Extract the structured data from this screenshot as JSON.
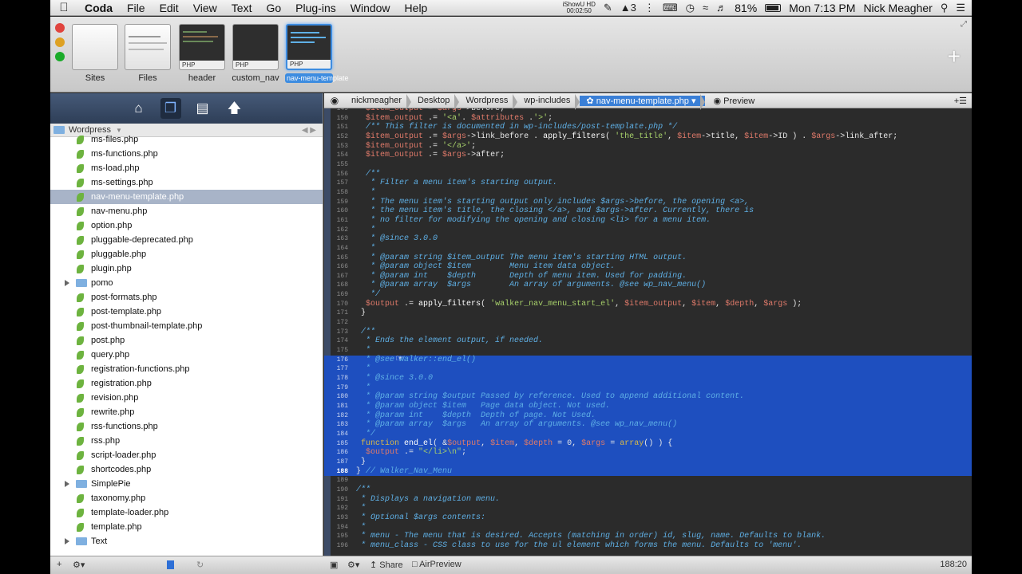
{
  "menubar": {
    "app": "Coda",
    "items": [
      "File",
      "Edit",
      "View",
      "Text",
      "Go",
      "Plug-ins",
      "Window",
      "Help"
    ],
    "recorder_top": "iShowU HD",
    "recorder_time": "00:02:50",
    "notif_count": "3",
    "battery": "81%",
    "clock": "Mon 7:13 PM",
    "user": "Nick Meagher"
  },
  "tabs": [
    {
      "label": "Sites"
    },
    {
      "label": "Files"
    },
    {
      "label": "header",
      "badge": "PHP"
    },
    {
      "label": "custom_nav",
      "badge": "PHP"
    },
    {
      "label": "nav-menu-template",
      "badge": "PHP"
    }
  ],
  "sidebar": {
    "crumb": "Wordpress",
    "files": [
      {
        "name": "ms-files.php",
        "type": "file"
      },
      {
        "name": "ms-functions.php",
        "type": "file"
      },
      {
        "name": "ms-load.php",
        "type": "file"
      },
      {
        "name": "ms-settings.php",
        "type": "file"
      },
      {
        "name": "nav-menu-template.php",
        "type": "file",
        "selected": true
      },
      {
        "name": "nav-menu.php",
        "type": "file"
      },
      {
        "name": "option.php",
        "type": "file"
      },
      {
        "name": "pluggable-deprecated.php",
        "type": "file"
      },
      {
        "name": "pluggable.php",
        "type": "file"
      },
      {
        "name": "plugin.php",
        "type": "file"
      },
      {
        "name": "pomo",
        "type": "dir"
      },
      {
        "name": "post-formats.php",
        "type": "file"
      },
      {
        "name": "post-template.php",
        "type": "file"
      },
      {
        "name": "post-thumbnail-template.php",
        "type": "file"
      },
      {
        "name": "post.php",
        "type": "file"
      },
      {
        "name": "query.php",
        "type": "file"
      },
      {
        "name": "registration-functions.php",
        "type": "file"
      },
      {
        "name": "registration.php",
        "type": "file"
      },
      {
        "name": "revision.php",
        "type": "file"
      },
      {
        "name": "rewrite.php",
        "type": "file"
      },
      {
        "name": "rss-functions.php",
        "type": "file"
      },
      {
        "name": "rss.php",
        "type": "file"
      },
      {
        "name": "script-loader.php",
        "type": "file"
      },
      {
        "name": "shortcodes.php",
        "type": "file"
      },
      {
        "name": "SimplePie",
        "type": "dir"
      },
      {
        "name": "taxonomy.php",
        "type": "file"
      },
      {
        "name": "template-loader.php",
        "type": "file"
      },
      {
        "name": "template.php",
        "type": "file"
      },
      {
        "name": "Text",
        "type": "dir"
      }
    ]
  },
  "pathbar": {
    "crumbs": [
      "nickmeagher",
      "Desktop",
      "Wordpress",
      "wp-includes"
    ],
    "current": "nav-menu-template.php",
    "preview": "Preview"
  },
  "code": {
    "lines": [
      {
        "n": "149",
        "h": "\t<span class='vr'>$item_output</span> = <span class='vr'>$args</span>->before;",
        "hl": false
      },
      {
        "n": "150",
        "h": "\t<span class='vr'>$item_output</span> .= <span class='st'>'&lt;a'</span>. <span class='vr'>$attributes</span> .<span class='st'>'&gt;'</span>;",
        "hl": false
      },
      {
        "n": "151",
        "h": "\t<span class='cm'>/** This filter is documented in wp-includes/post-template.php */</span>",
        "hl": false
      },
      {
        "n": "152",
        "h": "\t<span class='vr'>$item_output</span> .= <span class='vr'>$args</span>->link_before . <span class='fn'>apply_filters</span>( <span class='st'>'the_title'</span>, <span class='vr'>$item</span>->title, <span class='vr'>$item</span>->ID ) . <span class='vr'>$args</span>->link_after;",
        "hl": false
      },
      {
        "n": "153",
        "h": "\t<span class='vr'>$item_output</span> .= <span class='st'>'&lt;/a&gt;'</span>;",
        "hl": false
      },
      {
        "n": "154",
        "h": "\t<span class='vr'>$item_output</span> .= <span class='vr'>$args</span>->after;",
        "hl": false
      },
      {
        "n": "155",
        "h": "",
        "hl": false
      },
      {
        "n": "156",
        "h": "\t<span class='cm'>/**</span>",
        "hl": false
      },
      {
        "n": "157",
        "h": "\t<span class='cm'> * Filter a menu item's starting output.</span>",
        "hl": false
      },
      {
        "n": "158",
        "h": "\t<span class='cm'> *</span>",
        "hl": false
      },
      {
        "n": "159",
        "h": "\t<span class='cm'> * The menu item's starting output only includes $args->before, the opening &lt;a&gt;,</span>",
        "hl": false
      },
      {
        "n": "160",
        "h": "\t<span class='cm'> * the menu item's title, the closing &lt;/a&gt;, and $args->after. Currently, there is</span>",
        "hl": false
      },
      {
        "n": "161",
        "h": "\t<span class='cm'> * no filter for modifying the opening and closing &lt;li&gt; for a menu item.</span>",
        "hl": false
      },
      {
        "n": "162",
        "h": "\t<span class='cm'> *</span>",
        "hl": false
      },
      {
        "n": "163",
        "h": "\t<span class='cm'> * @since 3.0.0</span>",
        "hl": false
      },
      {
        "n": "164",
        "h": "\t<span class='cm'> *</span>",
        "hl": false
      },
      {
        "n": "165",
        "h": "\t<span class='cm'> * @param string $item_output The menu item's starting HTML output.</span>",
        "hl": false
      },
      {
        "n": "166",
        "h": "\t<span class='cm'> * @param object $item        Menu item data object.</span>",
        "hl": false
      },
      {
        "n": "167",
        "h": "\t<span class='cm'> * @param int    $depth       Depth of menu item. Used for padding.</span>",
        "hl": false
      },
      {
        "n": "168",
        "h": "\t<span class='cm'> * @param array  $args        An array of arguments. @see wp_nav_menu()</span>",
        "hl": false
      },
      {
        "n": "169",
        "h": "\t<span class='cm'> */</span>",
        "hl": false
      },
      {
        "n": "170",
        "h": "\t<span class='vr'>$output</span> .= <span class='fn'>apply_filters</span>( <span class='st'>'walker_nav_menu_start_el'</span>, <span class='vr'>$item_output</span>, <span class='vr'>$item</span>, <span class='vr'>$depth</span>, <span class='vr'>$args</span> );",
        "hl": false
      },
      {
        "n": "171",
        "h": " }",
        "hl": false
      },
      {
        "n": "172",
        "h": "",
        "hl": false
      },
      {
        "n": "173",
        "h": "<span class='cm'> /**</span>",
        "hl": false
      },
      {
        "n": "174",
        "h": "<span class='cm'>  * Ends the element output, if needed.</span>",
        "hl": false
      },
      {
        "n": "175",
        "h": "<span class='cm'>  *</span>",
        "hl": false
      },
      {
        "n": "176",
        "h": "<span class='cm'>  * @see Walker::end_el()</span>",
        "hl": true
      },
      {
        "n": "177",
        "h": "<span class='cm'>  *</span>",
        "hl": true
      },
      {
        "n": "178",
        "h": "<span class='cm'>  * @since 3.0.0</span>",
        "hl": true
      },
      {
        "n": "179",
        "h": "<span class='cm'>  *</span>",
        "hl": true
      },
      {
        "n": "180",
        "h": "<span class='cm'>  * @param string $output Passed by reference. Used to append additional content.</span>",
        "hl": true
      },
      {
        "n": "181",
        "h": "<span class='cm'>  * @param object $item   Page data object. Not used.</span>",
        "hl": true
      },
      {
        "n": "182",
        "h": "<span class='cm'>  * @param int    $depth  Depth of page. Not Used.</span>",
        "hl": true
      },
      {
        "n": "183",
        "h": "<span class='cm'>  * @param array  $args   An array of arguments. @see wp_nav_menu()</span>",
        "hl": true
      },
      {
        "n": "184",
        "h": "<span class='cm'>  */</span>",
        "hl": true
      },
      {
        "n": "185",
        "h": " <span class='kw'>function</span> <span class='fn'>end_el</span>( &amp;<span class='vr'>$output</span>, <span class='vr'>$item</span>, <span class='vr'>$depth</span> = 0, <span class='vr'>$args</span> = <span class='kw'>array</span>() ) {",
        "hl": true
      },
      {
        "n": "186",
        "h": "\t<span class='vr'>$output</span> .= <span class='st'>\"&lt;/li&gt;\\n\"</span>;",
        "hl": true
      },
      {
        "n": "187",
        "h": " }",
        "hl": true
      },
      {
        "n": "188",
        "h": "} <span class='cm'>// Walker_Nav_Menu</span>",
        "hl": true,
        "cur": true
      },
      {
        "n": "189",
        "h": "",
        "hl": false
      },
      {
        "n": "190",
        "h": "<span class='cm'>/**</span>",
        "hl": false
      },
      {
        "n": "191",
        "h": "<span class='cm'> * Displays a navigation menu.</span>",
        "hl": false
      },
      {
        "n": "192",
        "h": "<span class='cm'> *</span>",
        "hl": false
      },
      {
        "n": "193",
        "h": "<span class='cm'> * Optional $args contents:</span>",
        "hl": false
      },
      {
        "n": "194",
        "h": "<span class='cm'> *</span>",
        "hl": false
      },
      {
        "n": "195",
        "h": "<span class='cm'> * menu - The menu that is desired. Accepts (matching in order) id, slug, name. Defaults to blank.</span>",
        "hl": false
      },
      {
        "n": "196",
        "h": "<span class='cm'> * menu_class - CSS class to use for the ul element which forms the menu. Defaults to 'menu'.</span>",
        "hl": false
      }
    ]
  },
  "bottombar": {
    "share": "Share",
    "airpreview": "AirPreview",
    "position": "188:20"
  }
}
